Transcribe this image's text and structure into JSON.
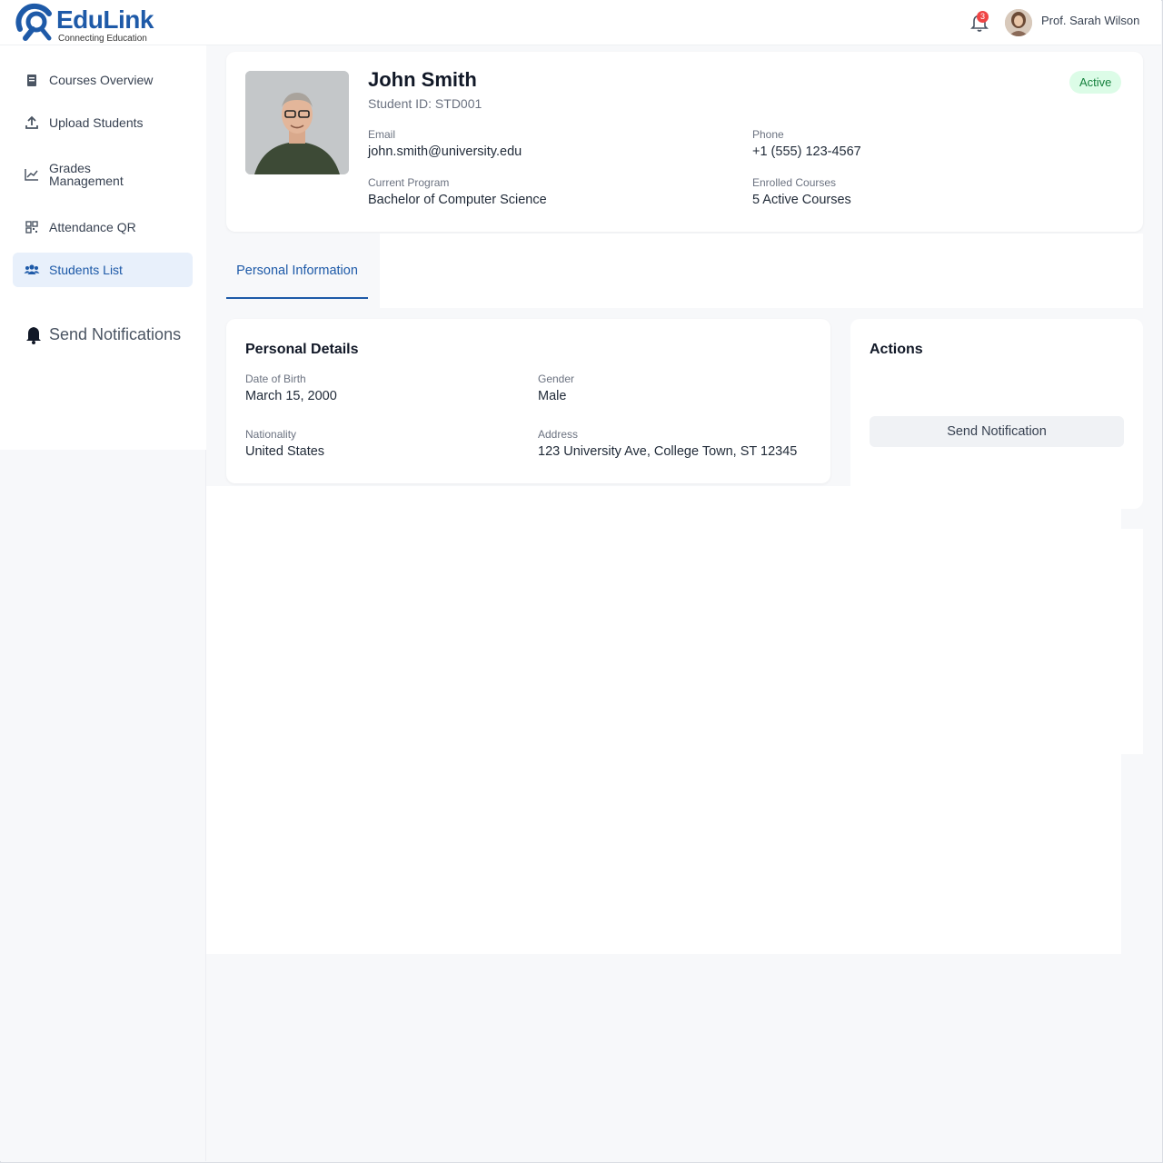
{
  "app": {
    "name": "EduLink",
    "tagline": "Connecting Education"
  },
  "header": {
    "notification_count": "3",
    "user_name": "Prof. Sarah Wilson"
  },
  "sidebar": {
    "items": [
      {
        "label": "Courses Overview",
        "icon": "book-icon"
      },
      {
        "label": "Upload Students",
        "icon": "upload-icon"
      },
      {
        "label": "Grades Management",
        "icon": "chart-line-icon"
      },
      {
        "label": "Attendance QR",
        "icon": "qr-code-icon"
      },
      {
        "label": "Students List",
        "icon": "users-icon",
        "active": true
      },
      {
        "label": "Send Notifications",
        "icon": "bell-icon"
      }
    ]
  },
  "student": {
    "name": "John Smith",
    "id_text": "Student ID: STD001",
    "status": "Active",
    "email_label": "Email",
    "email": "john.smith@university.edu",
    "phone_label": "Phone",
    "phone": "+1 (555) 123-4567",
    "program_label": "Current Program",
    "program": "Bachelor of Computer Science",
    "courses_label": "Enrolled Courses",
    "courses": "5 Active Courses"
  },
  "tabs": {
    "personal": "Personal Information"
  },
  "personal_details": {
    "title": "Personal Details",
    "dob_label": "Date of Birth",
    "dob": "March 15, 2000",
    "gender_label": "Gender",
    "gender": "Male",
    "nationality_label": "Nationality",
    "nationality": "United States",
    "address_label": "Address",
    "address": "123 University Ave, College Town, ST 12345"
  },
  "actions": {
    "title": "Actions",
    "send_label": "Send Notification"
  },
  "colors": {
    "brand": "#1e5aa8",
    "active_badge_bg": "#dcfce7",
    "active_badge_text": "#15803d",
    "notification_badge": "#ef4444"
  }
}
